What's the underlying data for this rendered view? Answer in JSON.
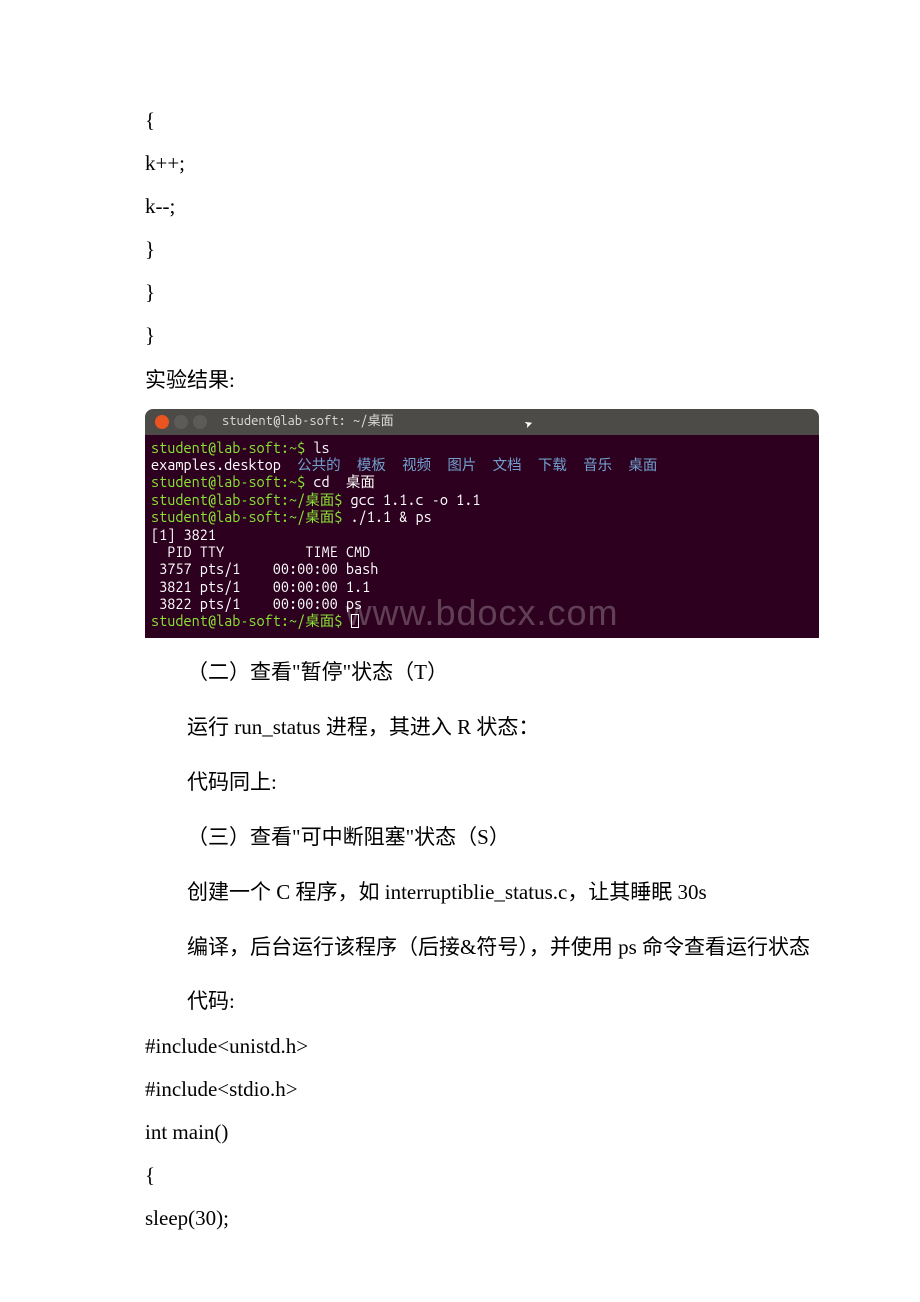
{
  "code_top": [
    "{",
    "k++;",
    "k--;",
    "}",
    "}",
    "}"
  ],
  "label_result": "实验结果:",
  "terminal": {
    "title": "student@lab-soft: ~/桌面",
    "lines": {
      "l1_prompt": "student@lab-soft:~$",
      "l1_cmd": " ls",
      "l2_file": "examples.desktop  ",
      "l2_dirs": "公共的  模板  视频  图片  文档  下载  音乐  桌面",
      "l3_prompt": "student@lab-soft:~$",
      "l3_cmd": " cd  桌面",
      "l4_prompt": "student@lab-soft:~/桌面$",
      "l4_cmd": " gcc 1.1.c -o 1.1",
      "l5_prompt": "student@lab-soft:~/桌面$",
      "l5_cmd": " ./1.1 & ps",
      "l6": "[1] 3821",
      "l7": "  PID TTY          TIME CMD",
      "l8": " 3757 pts/1    00:00:00 bash",
      "l9": " 3821 pts/1    00:00:00 1.1",
      "l10": " 3822 pts/1    00:00:00 ps",
      "l11_prompt": "student@lab-soft:~/桌面$",
      "l11_cmd": " "
    },
    "watermark": "www.bdocx.com"
  },
  "body": {
    "s2_title": "（二）查看\"暂停\"状态（T）",
    "s2_p1_a": "运行 ",
    "s2_p1_b": "run_status",
    "s2_p1_c": " 进程，其进入 R 状态：",
    "s2_p2": "代码同上:",
    "s3_title": "（三）查看\"可中断阻塞\"状态（S）",
    "s3_p1_a": "创建一个 C 程序，如 ",
    "s3_p1_b": "interruptiblie_status.c",
    "s3_p1_c": "，让其睡眠 30s",
    "s3_p2_a": "编译，后台运行该程序（后接&符号），并使用 ",
    "s3_p2_b": "ps",
    "s3_p2_c": " 命令查看运行状态",
    "s3_p3": "代码:"
  },
  "code_bottom": [
    "#include<unistd.h>",
    "#include<stdio.h>",
    "int main()",
    "{",
    " sleep(30);"
  ]
}
